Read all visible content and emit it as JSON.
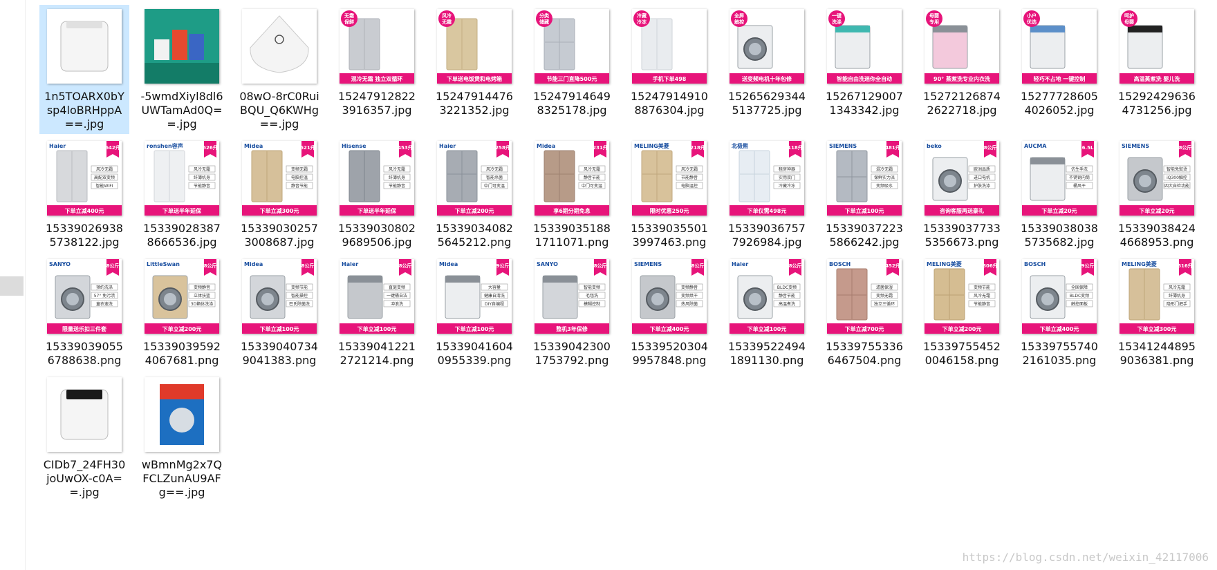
{
  "watermark": "https://blog.csdn.net/weixin_42117006",
  "files": [
    {
      "name": "1n5TOARX0bYsp4loBRHppA==.jpg",
      "thumb": "mini-fridge",
      "selected": true,
      "brand": "",
      "tag": "",
      "promo": "",
      "spec": "",
      "specs": []
    },
    {
      "name": "-5wmdXiyl8dl6UWTamAd0Q==.jpg",
      "thumb": "flyer",
      "brand": "",
      "tag": "",
      "promo": "",
      "spec": "",
      "specs": []
    },
    {
      "name": "08wO-8rC0RuiBQU_Q6KWHg==.jpg",
      "thumb": "heater",
      "brand": "",
      "tag": "",
      "promo": "",
      "spec": "",
      "specs": []
    },
    {
      "name": "152479128223916357.jpg",
      "thumb": "fridge-silver",
      "brand": "",
      "tag": "无霜保鲜",
      "promo": "混冷无霜 独立双循环",
      "spec": "",
      "specs": []
    },
    {
      "name": "152479144763221352.jpg",
      "thumb": "fridge-gold",
      "brand": "",
      "tag": "风冷无霜",
      "promo": "下单送电饭煲和电烤箱",
      "spec": "",
      "specs": []
    },
    {
      "name": "152479146498325178.jpg",
      "thumb": "fridge-3door",
      "brand": "",
      "tag": "分类储藏",
      "promo": "节能三门直降500元",
      "spec": "",
      "specs": []
    },
    {
      "name": "152479149108876304.jpg",
      "thumb": "fridge-white",
      "brand": "",
      "tag": "冷藏冷冻",
      "promo": "手机下单498",
      "spec": "",
      "specs": []
    },
    {
      "name": "152656293445137725.jpg",
      "thumb": "washer-front",
      "brand": "",
      "tag": "全屏触控",
      "promo": "送变频电机十年包修",
      "spec": "",
      "specs": []
    },
    {
      "name": "152671290071343342.jpg",
      "thumb": "washer-top-teal",
      "brand": "",
      "tag": "一键洗涤",
      "promo": "智能自由洗迷你全自动",
      "spec": "",
      "specs": []
    },
    {
      "name": "152721268742622718.jpg",
      "thumb": "washer-pink",
      "brand": "",
      "tag": "母婴专用",
      "promo": "90° 蒸煮洗专业内衣洗",
      "spec": "",
      "specs": []
    },
    {
      "name": "152777286054026052.jpg",
      "thumb": "washer-top-blue",
      "brand": "",
      "tag": "小户优选",
      "promo": "轻巧不占地 一键控制",
      "spec": "",
      "specs": []
    },
    {
      "name": "152924296364731256.jpg",
      "thumb": "washer-top-black",
      "brand": "",
      "tag": "呵护母婴",
      "promo": "高温蒸煮洗 婴儿洗",
      "spec": "",
      "specs": []
    },
    {
      "name": "153390269385738122.jpg",
      "thumb": "fridge-side",
      "brand": "Haier",
      "spec": "642升",
      "specs": [
        "风冷无霜",
        "高配双变频",
        "智能WIFI"
      ],
      "promo": "下单立减400元",
      "tag": ""
    },
    {
      "name": "153390283878666536.jpg",
      "thumb": "fridge-side-white",
      "brand": "ronshen容声",
      "spec": "526升",
      "specs": [
        "风冷无霜",
        "纤薄机身",
        "节能静音"
      ],
      "promo": "下单送半年延保",
      "tag": ""
    },
    {
      "name": "153390302573008687.jpg",
      "thumb": "fridge-side-gold",
      "brand": "Midea",
      "spec": "521升",
      "specs": [
        "变频无霜",
        "电脑控温",
        "静音节能"
      ],
      "promo": "下单立减300元",
      "tag": ""
    },
    {
      "name": "153390308029689506.jpg",
      "thumb": "fridge-side-dark",
      "brand": "Hisense",
      "spec": "453升",
      "specs": [
        "风冷无霜",
        "纤薄机身",
        "节能静音"
      ],
      "promo": "下单送半年延保",
      "tag": ""
    },
    {
      "name": "153390340825645212.png",
      "thumb": "fridge-3door-dark",
      "brand": "Haier",
      "spec": "258升",
      "specs": [
        "风冷无霜",
        "智能杀菌",
        "中门可变温"
      ],
      "promo": "下单立减200元",
      "tag": ""
    },
    {
      "name": "153390351881711071.png",
      "thumb": "fridge-3door-brown",
      "brand": "Midea",
      "spec": "231升",
      "specs": [
        "风冷无霜",
        "静音节能",
        "中门可变温"
      ],
      "promo": "享6期分期免息",
      "tag": ""
    },
    {
      "name": "153390355013997463.png",
      "thumb": "fridge-3door-gold",
      "brand": "MELING美菱",
      "spec": "218升",
      "specs": [
        "风冷无霜",
        "节能静音",
        "电脑温控"
      ],
      "promo": "限时优惠250元",
      "tag": ""
    },
    {
      "name": "153390367577926984.jpg",
      "thumb": "fridge-2door-white",
      "brand": "北极熊",
      "spec": "118升",
      "specs": [
        "租房神器",
        "实用双门",
        "冷藏冷冻"
      ],
      "promo": "下单仅需498元",
      "tag": ""
    },
    {
      "name": "153390372235866242.jpg",
      "thumb": "fridge-cross",
      "brand": "SIEMENS",
      "spec": "481升",
      "specs": [
        "混冷无霜",
        "保鲜实力派",
        "变频吸水"
      ],
      "promo": "下单立减100元",
      "tag": ""
    },
    {
      "name": "153390377335356673.png",
      "thumb": "washer-front-white",
      "brand": "beko",
      "spec": "8公斤",
      "specs": [
        "欧洲品质",
        "进口电机",
        "护肤洗涤"
      ],
      "promo": "咨询客服再送豪礼",
      "tag": ""
    },
    {
      "name": "153390380385735682.jpg",
      "thumb": "washer-top-white",
      "brand": "AUCMA",
      "spec": "6.5L",
      "specs": [
        "仿生手洗",
        "不锈钢内筒",
        "桶风干"
      ],
      "promo": "下单立减20元",
      "tag": ""
    },
    {
      "name": "153390384244668953.png",
      "thumb": "washer-front-grey",
      "brand": "SIEMENS",
      "spec": "8公斤",
      "specs": [
        "智能免熨烫",
        "iQ300触控",
        "四大自检功能"
      ],
      "promo": "下单立减20元",
      "tag": ""
    },
    {
      "name": "153390390556788638.png",
      "thumb": "washer-front-silver",
      "brand": "SANYO",
      "spec": "8公斤",
      "specs": [
        "预约洗涤",
        "57° 免污渍",
        "童衣速洗"
      ],
      "promo": "限量送乐扣三件套",
      "tag": ""
    },
    {
      "name": "153390395924067681.png",
      "thumb": "washer-front-gold",
      "brand": "LittleSwan",
      "spec": "8公斤",
      "specs": [
        "变频静音",
        "立体扶篮",
        "3D箱体洗涤"
      ],
      "promo": "下单立减200元",
      "tag": ""
    },
    {
      "name": "153390407349041383.png",
      "thumb": "washer-front-silver",
      "brand": "Midea",
      "spec": "8公斤",
      "specs": [
        "变频节能",
        "智能操控",
        "巴氏除菌洗"
      ],
      "promo": "下单立减100元",
      "tag": ""
    },
    {
      "name": "153390412212721214.png",
      "thumb": "washer-top-grey",
      "brand": "Haier",
      "spec": "8公斤",
      "specs": [
        "直驱变频",
        "一键桶自洁",
        "冲浪洗"
      ],
      "promo": "下单立减100元",
      "tag": ""
    },
    {
      "name": "153390416040955339.png",
      "thumb": "washer-top-open",
      "brand": "Midea",
      "spec": "9公斤",
      "specs": [
        "大容量",
        "健康自清洗",
        "DIY自编程"
      ],
      "promo": "下单立减100元",
      "tag": ""
    },
    {
      "name": "153390423001753792.png",
      "thumb": "washer-top-silver",
      "brand": "SANYO",
      "spec": "8公斤",
      "specs": [
        "智能变频",
        "毛毯洗",
        "模糊控制"
      ],
      "promo": "整机3年保修",
      "tag": ""
    },
    {
      "name": "153395203049957848.png",
      "thumb": "washer-front-grey",
      "brand": "SIEMENS",
      "spec": "8公斤",
      "specs": [
        "变频静音",
        "变频烘干",
        "热风除菌"
      ],
      "promo": "下单立减400元",
      "tag": ""
    },
    {
      "name": "153395224941891130.png",
      "thumb": "washer-front-white",
      "brand": "Haier",
      "spec": "8公斤",
      "specs": [
        "BLDC变频",
        "静音节能",
        "高温煮洗"
      ],
      "promo": "下单立减100元",
      "tag": ""
    },
    {
      "name": "153397553366467504.png",
      "thumb": "fridge-cross-rose",
      "brand": "BOSCH",
      "spec": "452升",
      "specs": [
        "滤菌保湿",
        "变频无霜",
        "独立三循环"
      ],
      "promo": "下单立减700元",
      "tag": ""
    },
    {
      "name": "153397554520046158.png",
      "thumb": "fridge-french-gold",
      "brand": "MELING美菱",
      "spec": "306升",
      "specs": [
        "变频节能",
        "风冷无霜",
        "节能静音"
      ],
      "promo": "下单立减200元",
      "tag": ""
    },
    {
      "name": "153397557402161035.png",
      "thumb": "washer-front-white",
      "brand": "BOSCH",
      "spec": "9公斤",
      "specs": [
        "全国保障",
        "BLDC变频",
        "触控面板"
      ],
      "promo": "下单立减400元",
      "tag": ""
    },
    {
      "name": "153412448959036381.png",
      "thumb": "fridge-side-gold",
      "brand": "MELING美菱",
      "spec": "516升",
      "specs": [
        "风冷无霜",
        "纤薄机身",
        "隐形门把手"
      ],
      "promo": "下单立减300元",
      "tag": ""
    },
    {
      "name": "CIDb7_24FH30joUwOX-c0A==.jpg",
      "thumb": "mini-fridge-black",
      "brand": "",
      "tag": "",
      "promo": "",
      "spec": "",
      "specs": []
    },
    {
      "name": "wBmnMg2x7QFCLZunAU9AFg==.jpg",
      "thumb": "detergent",
      "brand": "",
      "tag": "",
      "promo": "",
      "spec": "",
      "specs": []
    }
  ],
  "colors": {
    "promo_banner": "#e7147a",
    "selection": "#cce8ff",
    "tag_badge": "#e7147a"
  }
}
